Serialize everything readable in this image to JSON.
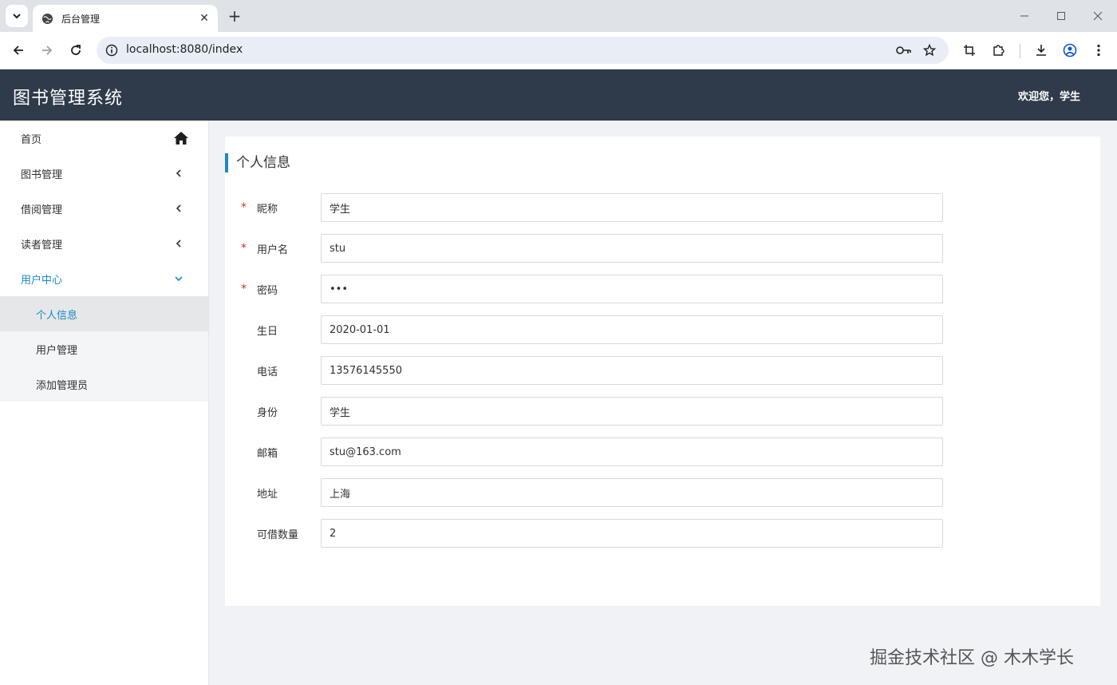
{
  "browser": {
    "tab_title": "后台管理",
    "url": "localhost:8080/index"
  },
  "header": {
    "app_title": "图书管理系统",
    "welcome": "欢迎您，学生"
  },
  "sidebar": {
    "items": [
      {
        "label": "首页",
        "icon": "home-icon"
      },
      {
        "label": "图书管理",
        "icon": "chevron-left-icon"
      },
      {
        "label": "借阅管理",
        "icon": "chevron-left-icon"
      },
      {
        "label": "读者管理",
        "icon": "chevron-left-icon"
      },
      {
        "label": "用户中心",
        "icon": "chevron-down-icon",
        "expanded": true
      }
    ],
    "sub_items": [
      {
        "label": "个人信息",
        "active": true
      },
      {
        "label": "用户管理"
      },
      {
        "label": "添加管理员"
      }
    ],
    "active_color": "#1989c8"
  },
  "main": {
    "card_title": "个人信息",
    "fields": [
      {
        "label": "昵称",
        "value": "学生",
        "required": true
      },
      {
        "label": "用户名",
        "value": "stu",
        "required": true
      },
      {
        "label": "密码",
        "value": "•••",
        "required": true
      },
      {
        "label": "生日",
        "value": "2020-01-01",
        "required": false
      },
      {
        "label": "电话",
        "value": "13576145550",
        "required": false
      },
      {
        "label": "身份",
        "value": "学生",
        "required": false
      },
      {
        "label": "邮箱",
        "value": "stu@163.com",
        "required": false
      },
      {
        "label": "地址",
        "value": "上海",
        "required": false
      },
      {
        "label": "可借数量",
        "value": "2",
        "required": false
      }
    ],
    "required_mark": "*"
  },
  "watermark": "掘金技术社区 @ 木木学长",
  "colors": {
    "header_bg": "#2f3a4a",
    "accent": "#1989c8",
    "main_bg": "#f0f2f5"
  }
}
